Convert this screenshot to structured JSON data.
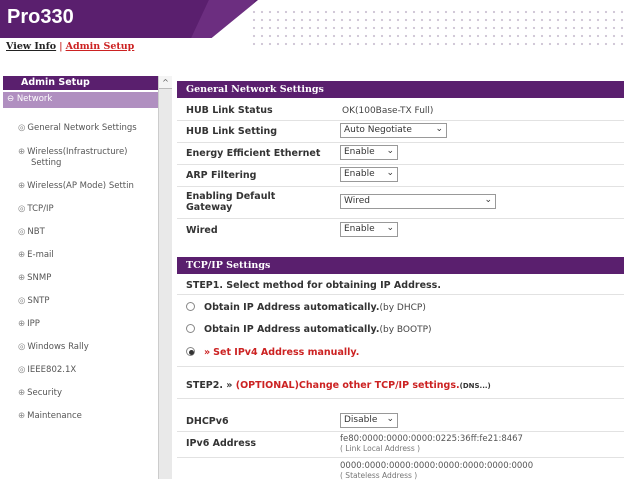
{
  "header": {
    "title": "Pro330",
    "view_info": "View Info",
    "separator": "|",
    "admin_setup": "Admin Setup"
  },
  "sidebar": {
    "title": "Admin Setup",
    "scroll_up": "^",
    "section": "Network",
    "items": [
      {
        "icon": "◎",
        "label": "General Network Settings"
      },
      {
        "icon": "⊕",
        "label": "Wireless(Infrastructure)"
      },
      {
        "icon": "",
        "label": "Setting"
      },
      {
        "icon": "⊕",
        "label": "Wireless(AP Mode) Settin"
      },
      {
        "icon": "◎",
        "label": "TCP/IP"
      },
      {
        "icon": "◎",
        "label": "NBT"
      },
      {
        "icon": "⊕",
        "label": "E-mail"
      },
      {
        "icon": "⊕",
        "label": "SNMP"
      },
      {
        "icon": "◎",
        "label": "SNTP"
      },
      {
        "icon": "⊕",
        "label": "IPP"
      },
      {
        "icon": "◎",
        "label": "Windows Rally"
      },
      {
        "icon": "◎",
        "label": "IEEE802.1X"
      },
      {
        "icon": "⊕",
        "label": "Security"
      },
      {
        "icon": "⊕",
        "label": "Maintenance"
      }
    ]
  },
  "general": {
    "title": "General Network Settings",
    "hub_status_label": "HUB Link Status",
    "hub_status_value": "OK(100Base-TX Full)",
    "hub_setting_label": "HUB Link Setting",
    "hub_setting_value": "Auto Negotiate",
    "eee_label": "Energy Efficient Ethernet",
    "eee_value": "Enable",
    "arp_label": "ARP Filtering",
    "arp_value": "Enable",
    "gateway_label_1": "Enabling Default",
    "gateway_label_2": "Gateway",
    "gateway_value": "Wired",
    "wired_label": "Wired",
    "wired_value": "Enable"
  },
  "tcpip": {
    "title": "TCP/IP Settings",
    "step1": "STEP1.  Select method for obtaining IP Address.",
    "opt_dhcp": "Obtain IP Address automatically.",
    "opt_dhcp_hint": "(by DHCP)",
    "opt_bootp": "Obtain IP Address automatically.",
    "opt_bootp_hint": "(by BOOTP)",
    "opt_manual_prefix": "»",
    "opt_manual": "Set IPv4 Address manually.",
    "step2_prefix": "STEP2.  »",
    "step2_text": "(OPTIONAL)Change other TCP/IP settings.",
    "step2_hint": "(DNS...)",
    "dhcpv6_label": "DHCPv6",
    "dhcpv6_value": "Disable",
    "ipv6_label": "IPv6 Address",
    "ipv6_link_local": "fe80:0000:0000:0000:0225:36ff:fe21:8467",
    "ipv6_link_local_sub": "( Link Local Address )",
    "ipv6_stateless": "0000:0000:0000:0000:0000:0000:0000:0000",
    "ipv6_stateless_sub": "( Stateless Address )"
  },
  "icons": {
    "chevron": "⌄",
    "radio_selected": "●"
  },
  "colors": {
    "brand": "#5a1f6e",
    "nav_active": "#b08fc0",
    "alert_red": "#c22222"
  }
}
